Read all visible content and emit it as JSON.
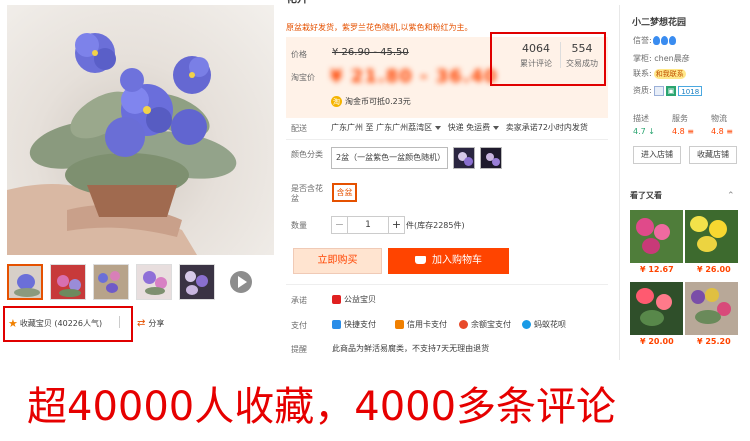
{
  "product": {
    "title_cut": "花卉",
    "subtitle": "原盆栽好发货，紫罗兰花色随机,以紫色和粉红为主。",
    "labels": {
      "price": "价格",
      "taobao_price": "淘宝价",
      "shipping": "配送",
      "color": "颜色分类",
      "pot": "是否含花盆",
      "quantity": "数量",
      "promise": "承诺",
      "payment": "支付",
      "notice": "提醒"
    },
    "original_price": "¥ 26.90 - 45.50",
    "current_price": "¥ 21.80 - 36.40",
    "coin_text": "淘金币可抵0.23元",
    "reviews_count": "4064",
    "reviews_label": "累计评论",
    "sales_count": "554",
    "sales_label": "交易成功",
    "shipping": {
      "origin": "广东广州 至",
      "destination": "广东广州荔湾区",
      "method": "快递 免运费",
      "promise": "卖家承诺72小时内发货"
    },
    "color_option": "2盆（一盆紫色一盆颜色随机）",
    "pot_option": "含盆",
    "quantity": "1",
    "stock": "件(库存2285件)",
    "buy_now": "立即购买",
    "add_to_cart": "加入购物车",
    "promise_item": "公益宝贝",
    "payments": [
      "快捷支付",
      "信用卡支付",
      "余额宝支付",
      "蚂蚁花呗"
    ],
    "notice_text": "此商品为鲜活易腐类，不支持7天无理由退货"
  },
  "gallery": {
    "favorite_text": "收藏宝贝 (40226人气)",
    "share_text": "分享"
  },
  "shop": {
    "name": "小二梦想花园",
    "reputation_label": "信誉:",
    "keeper_label": "掌柜:",
    "keeper_name": "chen晨彦",
    "contact_label": "联系:",
    "contact_badge": "和我联系",
    "qualification_label": "资质:",
    "qualification_badge": "1018",
    "dsr": [
      {
        "label": "描述",
        "value": "4.7 ↓",
        "color": "#2aa570"
      },
      {
        "label": "服务",
        "value": "4.8 ≡",
        "color": "#f40"
      },
      {
        "label": "物流",
        "value": "4.8 ≡",
        "color": "#f40"
      }
    ],
    "enter_shop": "进入店铺",
    "favorite_shop": "收藏店铺",
    "see_also_title": "看了又看",
    "see_also_arrow": "⌃",
    "recommendations": [
      {
        "price": "¥ 12.67"
      },
      {
        "price": "¥ 26.00"
      },
      {
        "price": "¥ 20.00"
      },
      {
        "price": "¥ 25.20"
      }
    ]
  },
  "caption": "超40000人收藏，4000多条评论",
  "colors": {
    "accent": "#ff4400",
    "highlight_box": "#e00000",
    "caption": "#e60000",
    "price_panel": "#fff2e8"
  }
}
